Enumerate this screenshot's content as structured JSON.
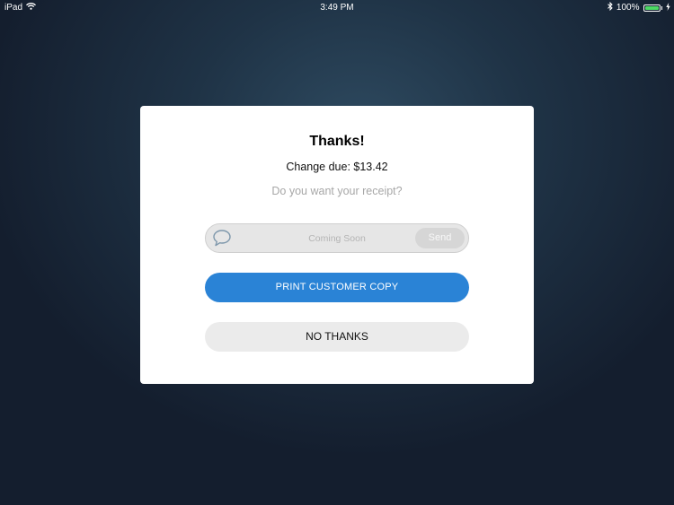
{
  "status_bar": {
    "device": "iPad",
    "time": "3:49 PM",
    "battery_percent": "100%",
    "battery_level": 1.0,
    "icons": [
      "wifi-icon",
      "bluetooth-icon",
      "battery-icon",
      "charging-icon"
    ]
  },
  "dialog": {
    "title": "Thanks!",
    "change_due": "Change due: $13.42",
    "question": "Do you want your receipt?",
    "sms": {
      "placeholder": "Coming Soon",
      "send_label": "Send",
      "icon": "chat-bubble-icon"
    },
    "print_label": "PRINT CUSTOMER COPY",
    "no_thanks_label": "NO THANKS"
  },
  "colors": {
    "primary_button": "#2a83d6",
    "secondary_button": "#ebebeb",
    "battery_fill": "#4cd964"
  }
}
